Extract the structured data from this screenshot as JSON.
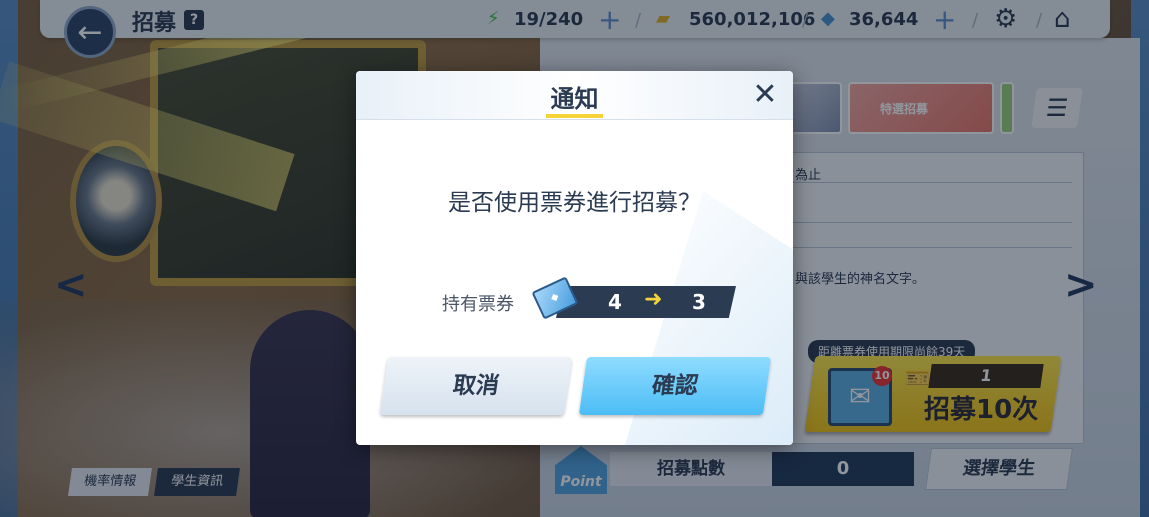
{
  "header": {
    "title": "招募",
    "help_label": "?",
    "stamina": "19/240",
    "credits": "560,012,106",
    "gems": "36,644"
  },
  "recruit": {
    "banner_text": "特選招募",
    "panel_line1": "為止",
    "panel_line2": "與該學生的神名文字。",
    "days_left": "距離票券使用期限尚餘39天",
    "ten_pull_count": "1",
    "ten_pull_label": "招募10次",
    "ten_pull_badge": "10"
  },
  "footer": {
    "point_badge": "Point",
    "recruit_points_label": "招募點數",
    "recruit_points_value": "0",
    "select_student_label": "選擇學生",
    "rate_info_label": "機率情報",
    "student_info_label": "學生資訊"
  },
  "dialog": {
    "title": "通知",
    "question": "是否使用票券進行招募？",
    "hold_label": "持有票券",
    "count_from": "4",
    "count_to": "3",
    "cancel_label": "取消",
    "confirm_label": "確認"
  },
  "colors": {
    "accent_yellow": "#f5d43a",
    "dark_navy": "#2b3b52",
    "confirm_blue": "#4cbdf5"
  }
}
